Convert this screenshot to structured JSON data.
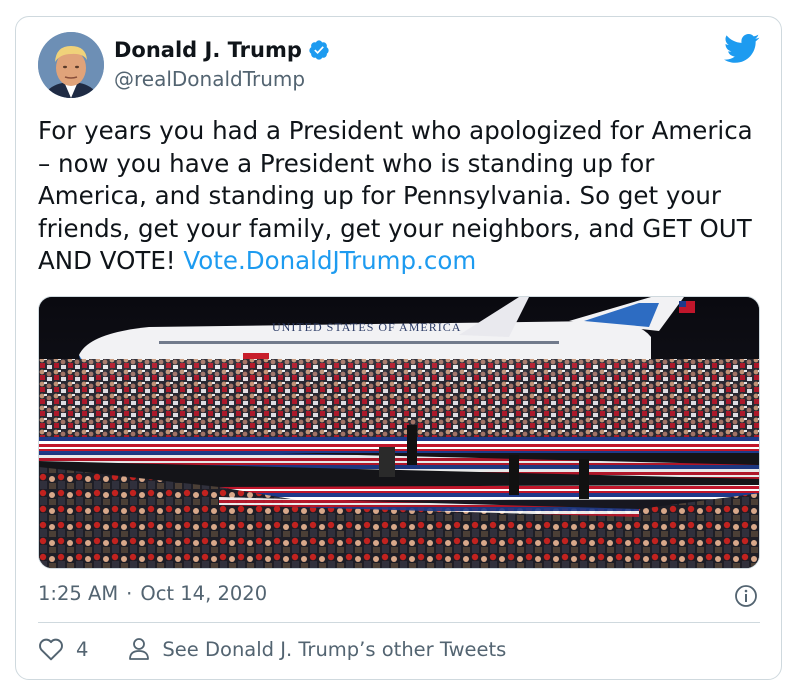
{
  "tweet": {
    "author": {
      "name": "Donald J. Trump",
      "handle": "@realDonaldTrump",
      "verified": true
    },
    "text": "For years you had a President who apologized for America – now you have a President who is standing up for America, and standing up for Pennsylvania. So get your friends, get your family, get your neighbors, and GET OUT AND VOTE! ",
    "link": "Vote.DonaldJTrump.com",
    "media": {
      "aircraft_lettering": "UNITED STATES OF AMERICA"
    },
    "time": "1:25 AM",
    "separator": "·",
    "date": "Oct 14, 2020",
    "likes": "4",
    "others_label": "See Donald J. Trump’s other Tweets"
  },
  "icons": {
    "brand": "twitter-bird-icon",
    "verified": "verified-badge-icon",
    "info": "info-icon",
    "like": "heart-icon",
    "profile": "person-icon"
  },
  "colors": {
    "accent": "#1d9bf0",
    "text": "#0f1419",
    "muted": "#536471",
    "border": "#cfd9de"
  }
}
